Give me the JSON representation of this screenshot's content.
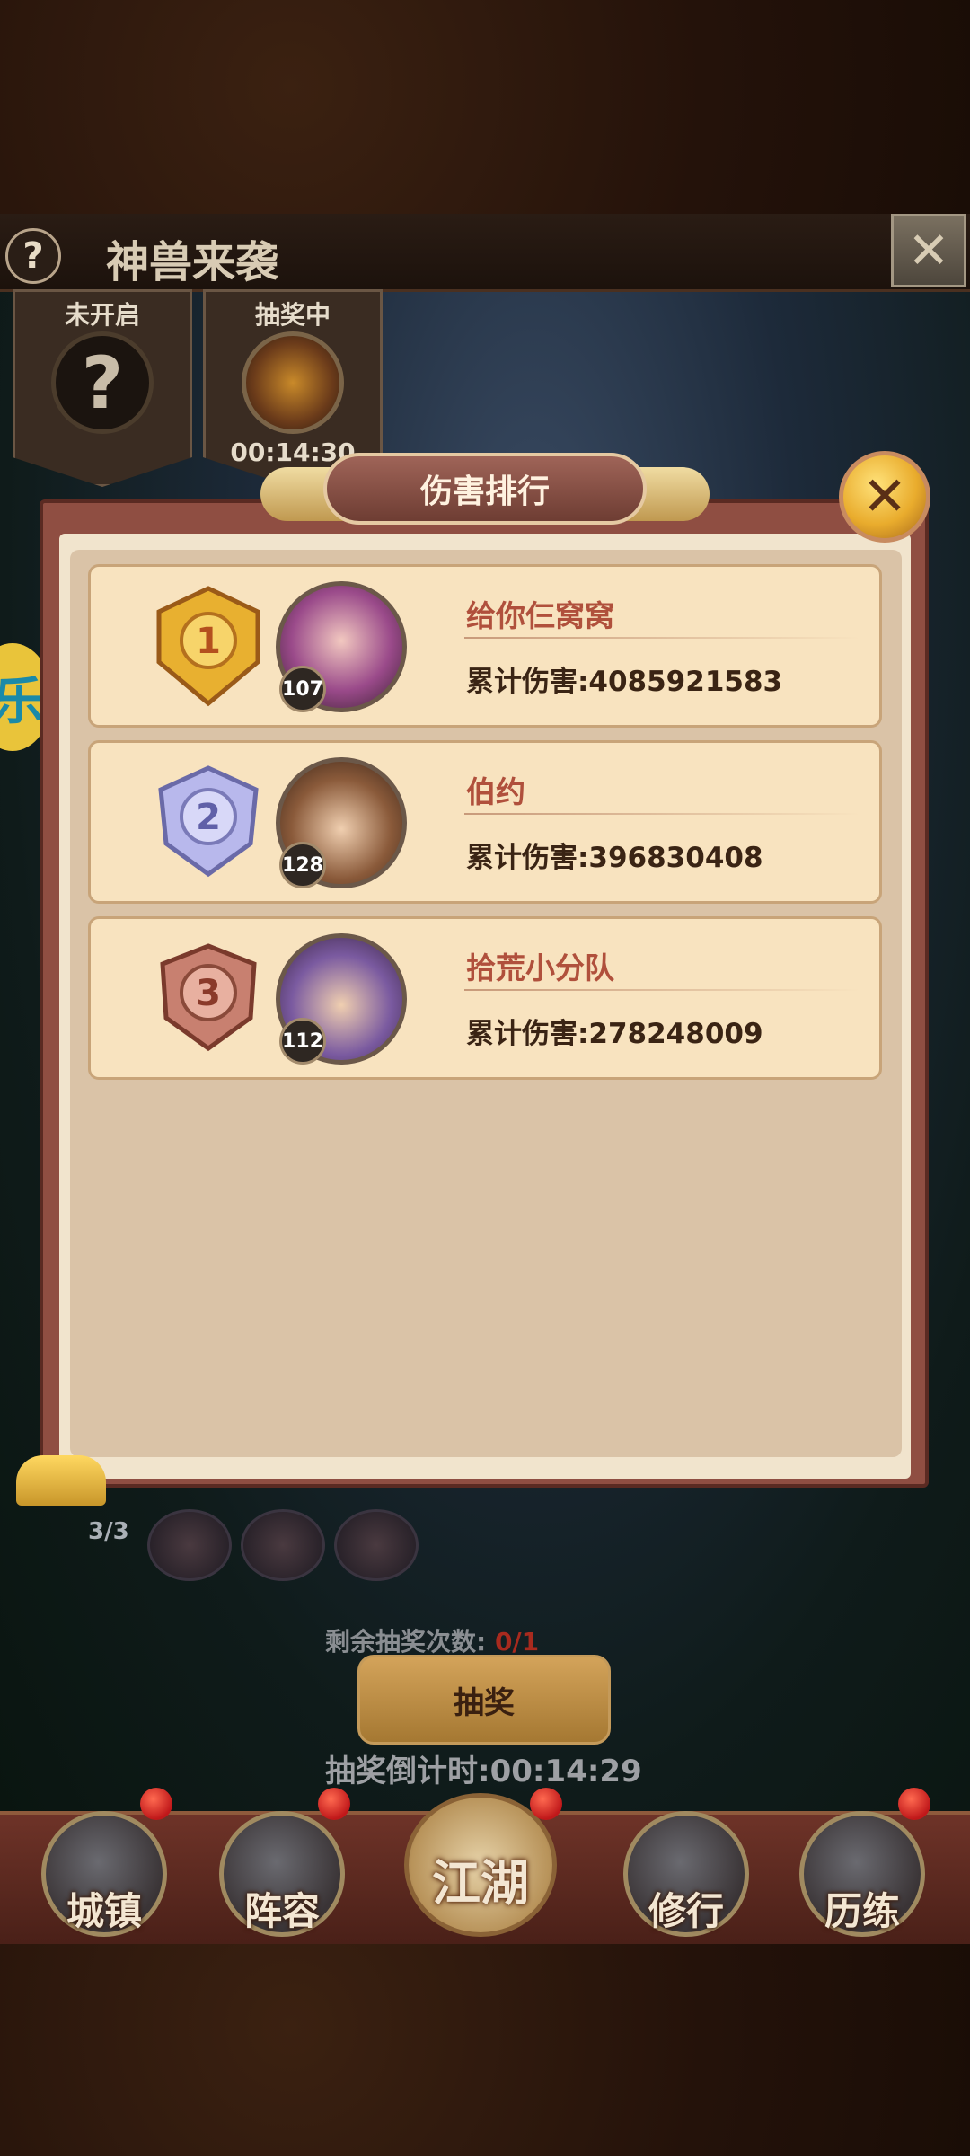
{
  "header": {
    "help_icon": "?",
    "title": "神兽来袭",
    "close_icon": "close-icon"
  },
  "stages": [
    {
      "label": "未开启",
      "icon": "?"
    },
    {
      "label": "抽奖中",
      "time": "00:14:30"
    }
  ],
  "side_badge": "乐",
  "ranking": {
    "title": "伤害排行",
    "damage_prefix": "累计伤害:",
    "rows": [
      {
        "rank": "1",
        "name": "给你仨窝窝",
        "level": "107",
        "damage": "累计伤害:4085921583",
        "medal_color": "#e8b030"
      },
      {
        "rank": "2",
        "name": "伯约",
        "level": "128",
        "damage": "累计伤害:396830408",
        "medal_color": "#a8a8e0"
      },
      {
        "rank": "3",
        "name": "拾荒小分队",
        "level": "112",
        "damage": "累计伤害:278248009",
        "medal_color": "#c87860"
      }
    ]
  },
  "bottom": {
    "team_count": "3/3",
    "remain_label": "剩余抽奖次数:",
    "remain_value": "0/1",
    "draw_button": "抽奖",
    "countdown": "抽奖倒计时:00:14:29"
  },
  "nav": {
    "items": [
      {
        "label": "城镇"
      },
      {
        "label": "阵容"
      },
      {
        "label": "江湖"
      },
      {
        "label": "修行"
      },
      {
        "label": "历练"
      }
    ]
  },
  "colors": {
    "panel_border": "#8f4e42",
    "row_bg": "#f8e3bf",
    "name_color": "#b0503c",
    "alert_dot": "#c0181a"
  }
}
